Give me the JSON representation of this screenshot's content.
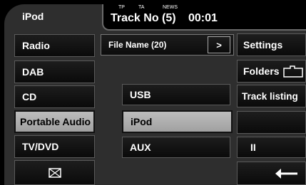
{
  "header": {
    "source_title": "iPod",
    "indicators": [
      "TP",
      "TA",
      "NEWS"
    ],
    "track_text": "Track No (5)",
    "clock": "00:01"
  },
  "left_menu": {
    "items": [
      {
        "label": "Radio"
      },
      {
        "label": "DAB"
      },
      {
        "label": "CD"
      },
      {
        "label": "Portable Audio",
        "selected": true
      },
      {
        "label": "TV/DVD"
      }
    ]
  },
  "file_bar": {
    "label": "File Name (20)",
    "arrow": ">"
  },
  "center_menu": {
    "items": [
      {
        "label": "USB"
      },
      {
        "label": "iPod",
        "selected": true
      },
      {
        "label": "AUX"
      }
    ]
  },
  "right_menu": {
    "settings": "Settings",
    "folders": "Folders",
    "track_listing": "Track listing",
    "pause": "II"
  },
  "footer": {
    "mail_icon": "envelope-icon",
    "back_icon": "return-arrow-icon"
  }
}
